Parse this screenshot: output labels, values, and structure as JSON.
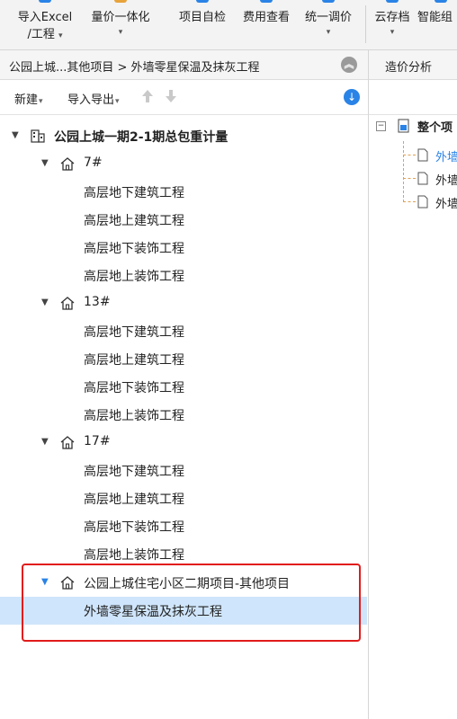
{
  "ribbon": {
    "tools": [
      {
        "line1": "导入Excel",
        "line2": "/工程",
        "caret": "▾",
        "stub_color": "#2a83e6"
      },
      {
        "line1": "量价一体化",
        "line2": "",
        "caret": "▾",
        "stub_color": "#e8a33b"
      },
      {
        "line1": "项目自检",
        "line2": "",
        "caret": "",
        "stub_color": "#2a83e6"
      },
      {
        "line1": "费用查看",
        "line2": "",
        "caret": "",
        "stub_color": "#2a83e6"
      },
      {
        "line1": "统一调价",
        "line2": "",
        "caret": "▾",
        "stub_color": "#2a83e6"
      },
      {
        "line1": "云存档",
        "line2": "",
        "caret": "▾",
        "stub_color": "#2a83e6"
      },
      {
        "line1": "智能组",
        "line2": "",
        "caret": "",
        "stub_color": "#2a83e6"
      }
    ]
  },
  "left_panel": {
    "breadcrumb": "公园上城...其他项目 > 外墙零星保温及抹灰工程",
    "collapse_icon": "double-chevron-up-icon",
    "toolbar": {
      "new_label": "新建",
      "import_export_label": "导入导出",
      "caret": "▾",
      "up_icon": "arrow-up-icon",
      "down_icon": "arrow-down-icon",
      "download_icon": "download-icon"
    },
    "tree": {
      "root": "公园上城一期2-1期总包重计量",
      "toggle_expanded": "▼",
      "groups": [
        {
          "name": "7#",
          "children": [
            "高层地下建筑工程",
            "高层地上建筑工程",
            "高层地下装饰工程",
            "高层地上装饰工程"
          ]
        },
        {
          "name": "13#",
          "children": [
            "高层地下建筑工程",
            "高层地上建筑工程",
            "高层地下装饰工程",
            "高层地上装饰工程"
          ]
        },
        {
          "name": "17#",
          "children": [
            "高层地下建筑工程",
            "高层地上建筑工程",
            "高层地下装饰工程",
            "高层地上装饰工程"
          ]
        },
        {
          "name": "公园上城住宅小区二期项目-其他项目",
          "children": [
            "外墙零星保温及抹灰工程"
          ]
        }
      ],
      "selected_item": "外墙零星保温及抹灰工程"
    }
  },
  "right_panel": {
    "tab": "造价分析",
    "tree": {
      "root_label": "整个项",
      "children": [
        {
          "label": "外墙",
          "color": "#2a83e6"
        },
        {
          "label": "外墙",
          "color": "#222222"
        },
        {
          "label": "外墙",
          "color": "#222222"
        }
      ]
    }
  },
  "colors": {
    "accent": "#2a83e6",
    "selected_row": "#cfe5fb",
    "highlight_border": "#e21b1b"
  }
}
